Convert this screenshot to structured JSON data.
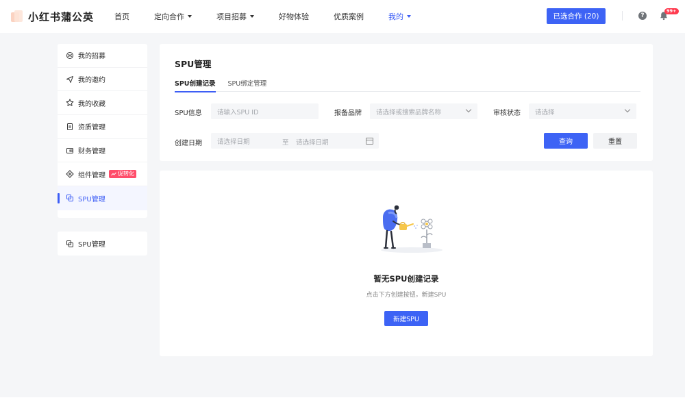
{
  "app": {
    "logo_text": "小红书蒲公英"
  },
  "nav": {
    "items": [
      {
        "label": "首页",
        "has_caret": false
      },
      {
        "label": "定向合作",
        "has_caret": true
      },
      {
        "label": "项目招募",
        "has_caret": true
      },
      {
        "label": "好物体验",
        "has_caret": false
      },
      {
        "label": "优质案例",
        "has_caret": false
      },
      {
        "label": "我的",
        "has_caret": true,
        "active": true
      }
    ],
    "selected_button": "已选合作 (20)",
    "notification_badge": "99+"
  },
  "sidebar": {
    "items": [
      {
        "label": "我的招募",
        "icon": "recruit-icon"
      },
      {
        "label": "我的邀约",
        "icon": "send-icon"
      },
      {
        "label": "我的收藏",
        "icon": "star-icon"
      },
      {
        "label": "资质管理",
        "icon": "document-icon"
      },
      {
        "label": "财务管理",
        "icon": "wallet-icon"
      },
      {
        "label": "组件管理",
        "icon": "component-icon",
        "tag": "促转化"
      },
      {
        "label": "SPU管理",
        "icon": "spu-icon",
        "active": true
      }
    ],
    "secondary_item": {
      "label": "SPU管理",
      "icon": "spu-icon"
    }
  },
  "filter": {
    "page_title": "SPU管理",
    "tabs": [
      {
        "label": "SPU创建记录",
        "active": true
      },
      {
        "label": "SPU绑定管理",
        "active": false
      }
    ],
    "spu_label": "SPU信息",
    "spu_placeholder": "请输入SPU ID",
    "brand_label": "报备品牌",
    "brand_placeholder": "请选择或搜索品牌名称",
    "status_label": "审核状态",
    "status_placeholder": "请选择",
    "date_label": "创建日期",
    "date_start_placeholder": "请选择日期",
    "date_separator": "至",
    "date_end_placeholder": "请选择日期",
    "query_button": "查询",
    "reset_button": "重置"
  },
  "empty_state": {
    "title": "暂无SPU创建记录",
    "subtitle": "点击下方创建按钮，新建SPU",
    "button": "新建SPU"
  },
  "colors": {
    "primary": "#3d63f5",
    "badge": "#ff3b4f",
    "promo_tag": "#ff4d6a",
    "page_bg": "#f5f6f8"
  }
}
